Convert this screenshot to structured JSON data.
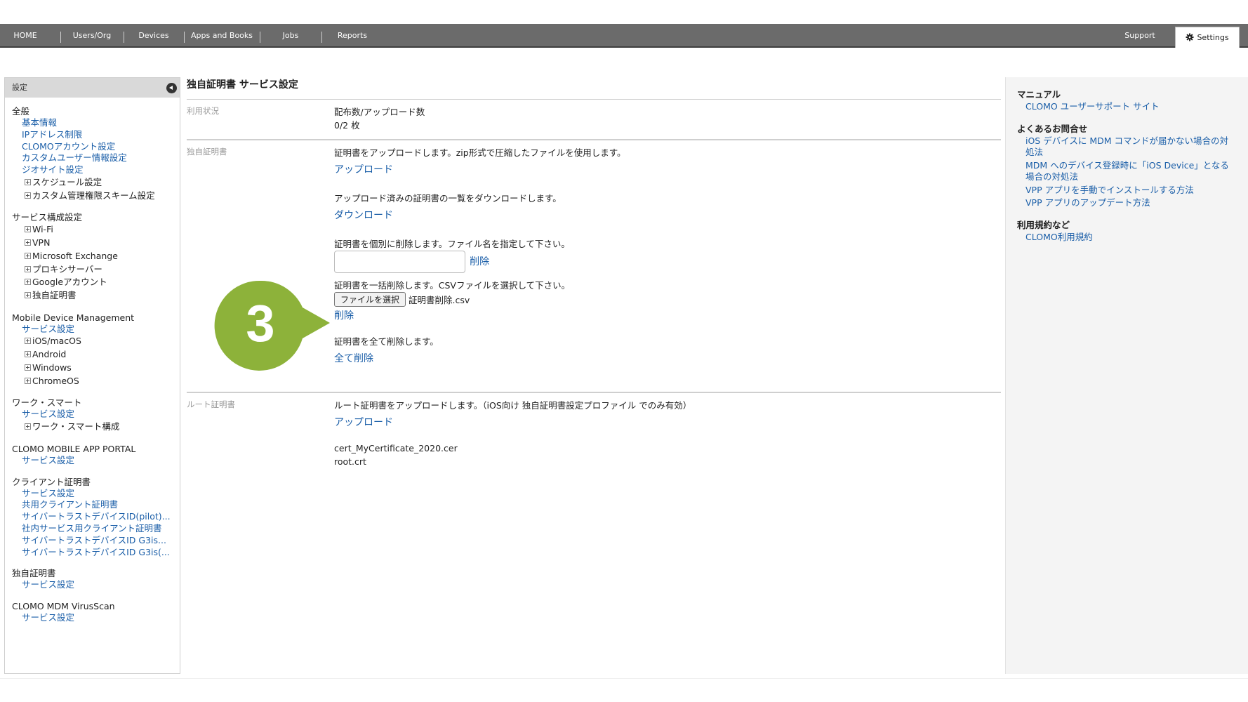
{
  "topnav": {
    "items": [
      "HOME",
      "Users/Org",
      "Devices",
      "Apps and Books",
      "Jobs",
      "Reports"
    ],
    "support": "Support",
    "settings": "Settings"
  },
  "sidebar": {
    "header": "設定",
    "sections": [
      {
        "title": "全般",
        "items": [
          {
            "label": "基本情報",
            "type": "link"
          },
          {
            "label": "IPアドレス制限",
            "type": "link"
          },
          {
            "label": "CLOMOアカウント設定",
            "type": "link"
          },
          {
            "label": "カスタムユーザー情報設定",
            "type": "link"
          },
          {
            "label": "ジオサイト設定",
            "type": "link"
          },
          {
            "label": "スケジュール設定",
            "type": "expand"
          },
          {
            "label": "カスタム管理権限スキーム設定",
            "type": "expand"
          }
        ]
      },
      {
        "title": "サービス構成設定",
        "items": [
          {
            "label": "Wi-Fi",
            "type": "expand"
          },
          {
            "label": "VPN",
            "type": "expand"
          },
          {
            "label": "Microsoft Exchange",
            "type": "expand"
          },
          {
            "label": "プロキシサーバー",
            "type": "expand"
          },
          {
            "label": "Googleアカウント",
            "type": "expand"
          },
          {
            "label": "独自証明書",
            "type": "expand"
          }
        ]
      },
      {
        "title": "Mobile Device Management",
        "items": [
          {
            "label": "サービス設定",
            "type": "link"
          },
          {
            "label": "iOS/macOS",
            "type": "expand"
          },
          {
            "label": "Android",
            "type": "expand"
          },
          {
            "label": "Windows",
            "type": "expand"
          },
          {
            "label": "ChromeOS",
            "type": "expand"
          }
        ]
      },
      {
        "title": "ワーク・スマート",
        "items": [
          {
            "label": "サービス設定",
            "type": "link"
          },
          {
            "label": "ワーク・スマート構成",
            "type": "expand"
          }
        ]
      },
      {
        "title": "CLOMO MOBILE APP PORTAL",
        "items": [
          {
            "label": "サービス設定",
            "type": "link"
          }
        ]
      },
      {
        "title": "クライアント証明書",
        "items": [
          {
            "label": "サービス設定",
            "type": "link"
          },
          {
            "label": "共用クライアント証明書",
            "type": "link"
          },
          {
            "label": "サイバートラストデバイスID(pilot)...",
            "type": "link"
          },
          {
            "label": "社内サービス用クライアント証明書",
            "type": "link"
          },
          {
            "label": "サイバートラストデバイスID G3is...",
            "type": "link"
          },
          {
            "label": "サイバートラストデバイスID G3is(...",
            "type": "link"
          }
        ]
      },
      {
        "title": "独自証明書",
        "items": [
          {
            "label": "サービス設定",
            "type": "link"
          }
        ]
      },
      {
        "title": "CLOMO MDM VirusScan",
        "items": [
          {
            "label": "サービス設定",
            "type": "link"
          }
        ]
      }
    ]
  },
  "main": {
    "title": "独自証明書 サービス設定",
    "usage": {
      "label": "利用状況",
      "heading": "配布数/アップロード数",
      "value": "0/2 枚"
    },
    "cert": {
      "label": "独自証明書",
      "upload_desc": "証明書をアップロードします。zip形式で圧縮したファイルを使用します。",
      "upload_link": "アップロード",
      "download_desc": "アップロード済みの証明書の一覧をダウンロードします。",
      "download_link": "ダウンロード",
      "delete_single_desc": "証明書を個別に削除します。ファイル名を指定して下さい。",
      "delete_single_link": "削除",
      "delete_bulk_desc": "証明書を一括削除します。CSVファイルを選択して下さい。",
      "choose_file_button": "ファイルを選択",
      "chosen_file": "証明書削除.csv",
      "delete_bulk_link": "削除",
      "delete_all_desc": "証明書を全て削除します。",
      "delete_all_link": "全て削除"
    },
    "root": {
      "label": "ルート証明書",
      "upload_desc": "ルート証明書をアップロードします。（iOS向け 独自証明書設定プロファイル でのみ有効）",
      "upload_link": "アップロード",
      "files": [
        "cert_MyCertificate_2020.cer",
        "root.crt"
      ]
    }
  },
  "callout": {
    "number": "3",
    "color": "#8db23a"
  },
  "rightpane": {
    "sections": [
      {
        "title": "マニュアル",
        "links": [
          "CLOMO ユーザーサポート サイト"
        ]
      },
      {
        "title": "よくあるお問合せ",
        "links": [
          "iOS デバイスに MDM コマンドが届かない場合の対処法",
          "MDM へのデバイス登録時に「iOS Device」となる場合の対処法",
          "VPP アプリを手動でインストールする方法",
          "VPP アプリのアップデート方法"
        ]
      },
      {
        "title": "利用規約など",
        "links": [
          "CLOMO利用規約"
        ]
      }
    ]
  }
}
